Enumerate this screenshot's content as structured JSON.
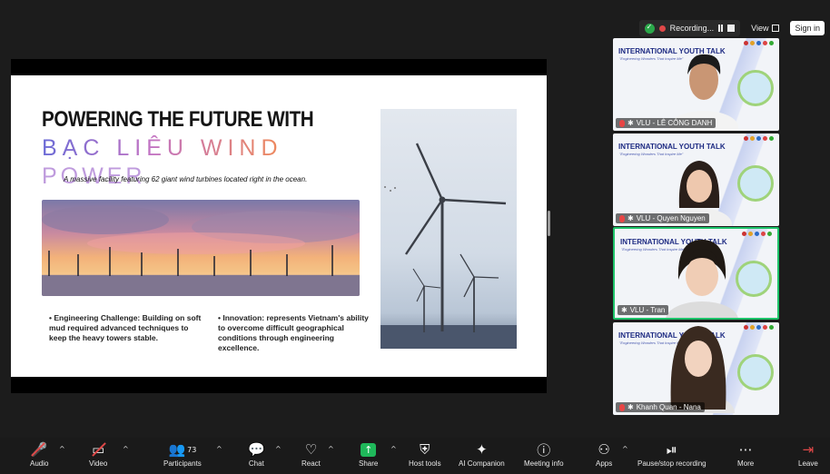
{
  "topbar": {
    "recording_label": "Recording...",
    "view_label": "View",
    "signin_label": "Sign in"
  },
  "slide": {
    "title_line1": "POWERING THE FUTURE WITH",
    "title_line2": "BẠC LIÊU WIND",
    "title_line3": "POWER",
    "subtitle": "A massive facility featuring 62 giant wind turbines located right in the ocean.",
    "bullet_left": "• Engineering Challenge: Building on soft mud required advanced techniques to keep the heavy towers stable.",
    "bullet_right": "• Innovation: represents Vietnam's ability to overcome difficult geographical conditions through engineering excellence."
  },
  "participants": [
    {
      "name": "VLU - LÊ CÔNG DANH",
      "banner": "INTERNATIONAL YOUTH TALK",
      "banner_sub": "\"Engineering Wonders That Inspire Me\""
    },
    {
      "name": "VLU - Quyen Nguyen",
      "banner": "INTERNATIONAL YOUTH TALK",
      "banner_sub": "\"Engineering Wonders That Inspire Me\""
    },
    {
      "name": "VLU - Tran",
      "banner": "INTERNATIONAL YOUTH TALK",
      "banner_sub": "\"Engineering Wonders That Inspire Me\""
    },
    {
      "name": "Khanh Quan - Nana",
      "banner": "INTERNATIONAL YOUTH TALK",
      "banner_sub": "\"Engineering Wonders That Inspire Me\""
    }
  ],
  "toolbar": {
    "audio": "Audio",
    "video": "Video",
    "participants": "Participants",
    "participants_count": "73",
    "chat": "Chat",
    "react": "React",
    "share": "Share",
    "host_tools": "Host tools",
    "ai_companion": "AI Companion",
    "meeting_info": "Meeting info",
    "apps": "Apps",
    "pause_stop": "Pause/stop recording",
    "more": "More",
    "leave": "Leave"
  },
  "colors": {
    "active_speaker": "#1ec36a",
    "share_green": "#1fb85a",
    "recording_red": "#e04848"
  }
}
